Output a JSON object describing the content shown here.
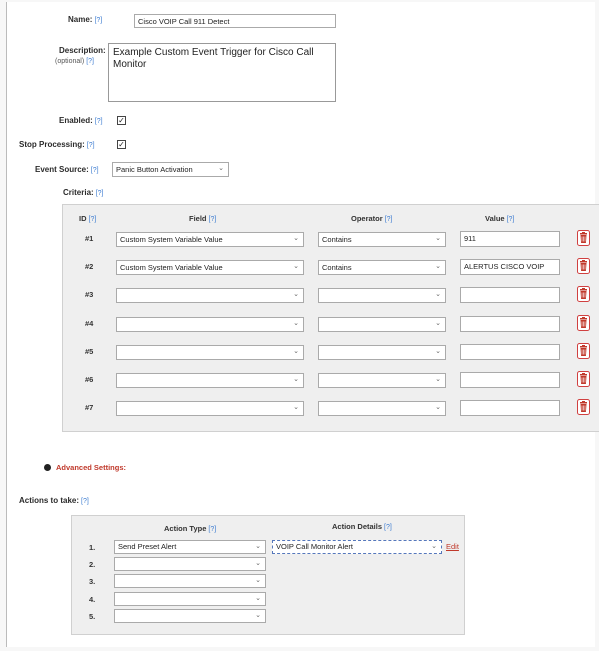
{
  "help_marker": "[?]",
  "name": {
    "label": "Name:",
    "value": "Cisco VOIP Call 911 Detect"
  },
  "description": {
    "label": "Description:",
    "optional": "(optional)",
    "value": "Example Custom Event Trigger for Cisco Call Monitor"
  },
  "enabled": {
    "label": "Enabled:",
    "checked": true
  },
  "stop_processing": {
    "label": "Stop Processing:",
    "checked": true
  },
  "event_source": {
    "label": "Event Source:",
    "value": "Panic Button Activation"
  },
  "criteria": {
    "label": "Criteria:",
    "headers": {
      "id": "ID",
      "field": "Field",
      "operator": "Operator",
      "value": "Value"
    },
    "rows": [
      {
        "id": "#1",
        "field": "Custom System Variable Value",
        "operator": "Contains",
        "value": "911"
      },
      {
        "id": "#2",
        "field": "Custom System Variable Value",
        "operator": "Contains",
        "value": "ALERTUS CISCO VOIP"
      },
      {
        "id": "#3",
        "field": "",
        "operator": "",
        "value": ""
      },
      {
        "id": "#4",
        "field": "",
        "operator": "",
        "value": ""
      },
      {
        "id": "#5",
        "field": "",
        "operator": "",
        "value": ""
      },
      {
        "id": "#6",
        "field": "",
        "operator": "",
        "value": ""
      },
      {
        "id": "#7",
        "field": "",
        "operator": "",
        "value": ""
      }
    ]
  },
  "advanced_settings": "Advanced Settings:",
  "actions": {
    "label": "Actions to take:",
    "headers": {
      "action_type": "Action Type",
      "action_details": "Action Details"
    },
    "rows": [
      {
        "num": "1.",
        "type": "Send Preset Alert",
        "details": "VOIP Call Monitor Alert",
        "edit": "Edit"
      },
      {
        "num": "2.",
        "type": ""
      },
      {
        "num": "3.",
        "type": ""
      },
      {
        "num": "4.",
        "type": ""
      },
      {
        "num": "5.",
        "type": ""
      }
    ]
  },
  "icons": {
    "trash": "trash-icon",
    "dropdown": "chevron-down-icon",
    "help": "help-icon",
    "expand": "expand-circle-icon"
  },
  "colors": {
    "help": "#3b7bd1",
    "link": "#c0392b",
    "trash": "#c0392b"
  }
}
